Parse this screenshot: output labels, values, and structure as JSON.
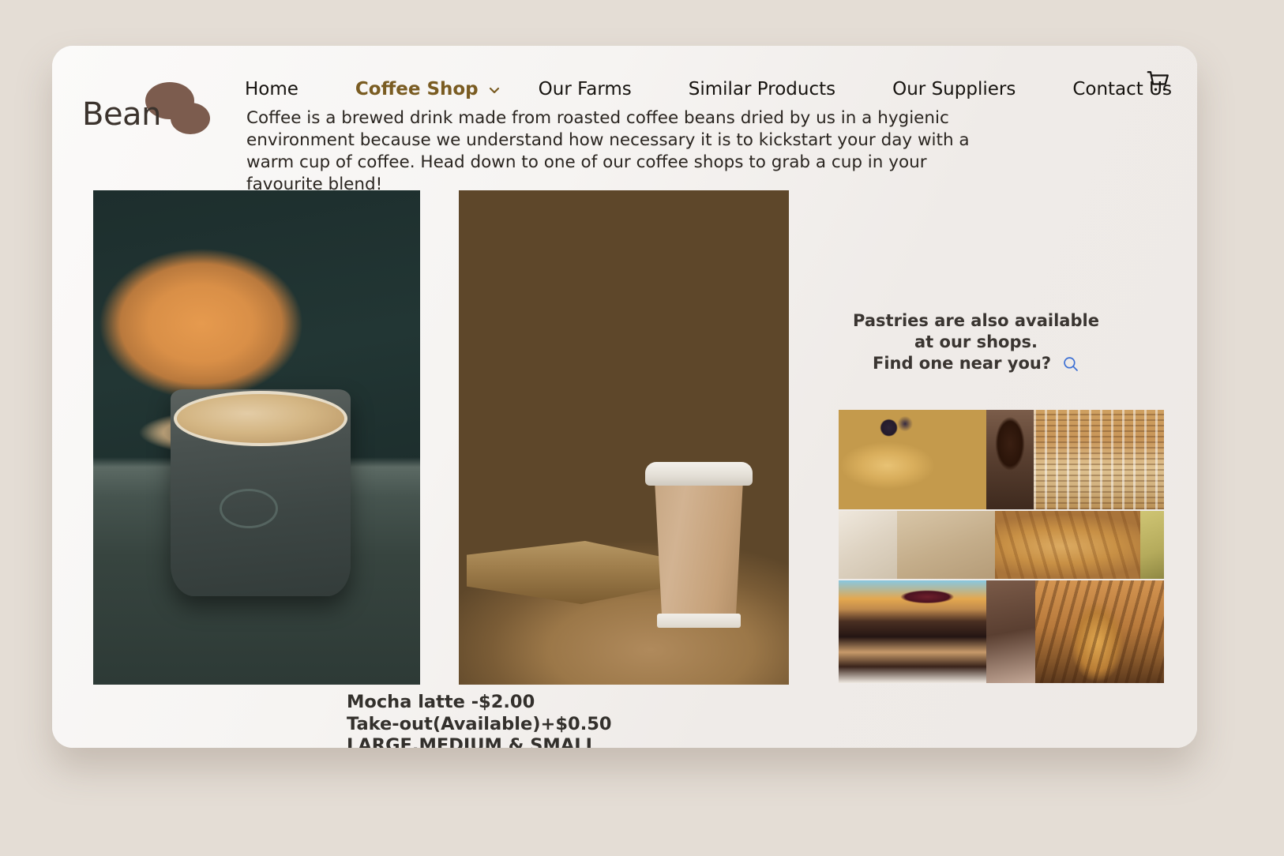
{
  "theme": {
    "page_background": "#e4ddd5",
    "card_background": "#f7f6f4",
    "accent_brown": "#7a5c22",
    "logo_bean_color": "#7c5c4e",
    "text_color": "#2a2520",
    "search_icon_color": "#3b6fd4"
  },
  "brand": {
    "name": "Bean",
    "logo_icon": "coffee-beans-icon"
  },
  "nav": {
    "items": [
      {
        "label": "Home",
        "active": false,
        "has_dropdown": false
      },
      {
        "label": "Coffee Shop",
        "active": true,
        "has_dropdown": true,
        "dropdown_icon": "chevron-down-icon"
      },
      {
        "label": "Our Farms",
        "active": false,
        "has_dropdown": false
      },
      {
        "label": "Similar Products",
        "active": false,
        "has_dropdown": false
      },
      {
        "label": "Our Suppliers",
        "active": false,
        "has_dropdown": false
      },
      {
        "label": "Contact Us",
        "active": false,
        "has_dropdown": false
      }
    ],
    "cart_icon": "shopping-cart-icon"
  },
  "intro": {
    "paragraph": "Coffee is a brewed drink made from roasted coffee beans dried by us in a hygienic environment because we understand how necessary it is to kickstart your day with a warm cup of coffee. Head down to one of our coffee shops to grab a cup in your favourite blend!"
  },
  "gallery": {
    "left_photo_alt": "latte-in-cup-photo",
    "middle_photo_alt": "takeaway-coffee-cup-on-table-photo"
  },
  "promo": {
    "line1": "Pastries are also available",
    "line2": "at our shops.",
    "line3": "Find one near you?",
    "search_icon": "search-icon",
    "collage": [
      {
        "row": 1,
        "cells": [
          "pancakes-with-blueberries",
          "coffee-cup",
          "stacked-cookies-display"
        ]
      },
      {
        "row": 2,
        "cells": [
          "paper-wrapper",
          "brown-paper",
          "almond-croissant",
          "pear"
        ]
      },
      {
        "row": 3,
        "cells": [
          "chocolate-layer-cake-slice",
          "bun",
          "assorted-pastries-display"
        ]
      }
    ]
  },
  "product": {
    "line1": "Mocha latte -$2.00",
    "line2": "Take-out(Available)+$0.50",
    "line3": "LARGE,MEDIUM & SMALL"
  }
}
